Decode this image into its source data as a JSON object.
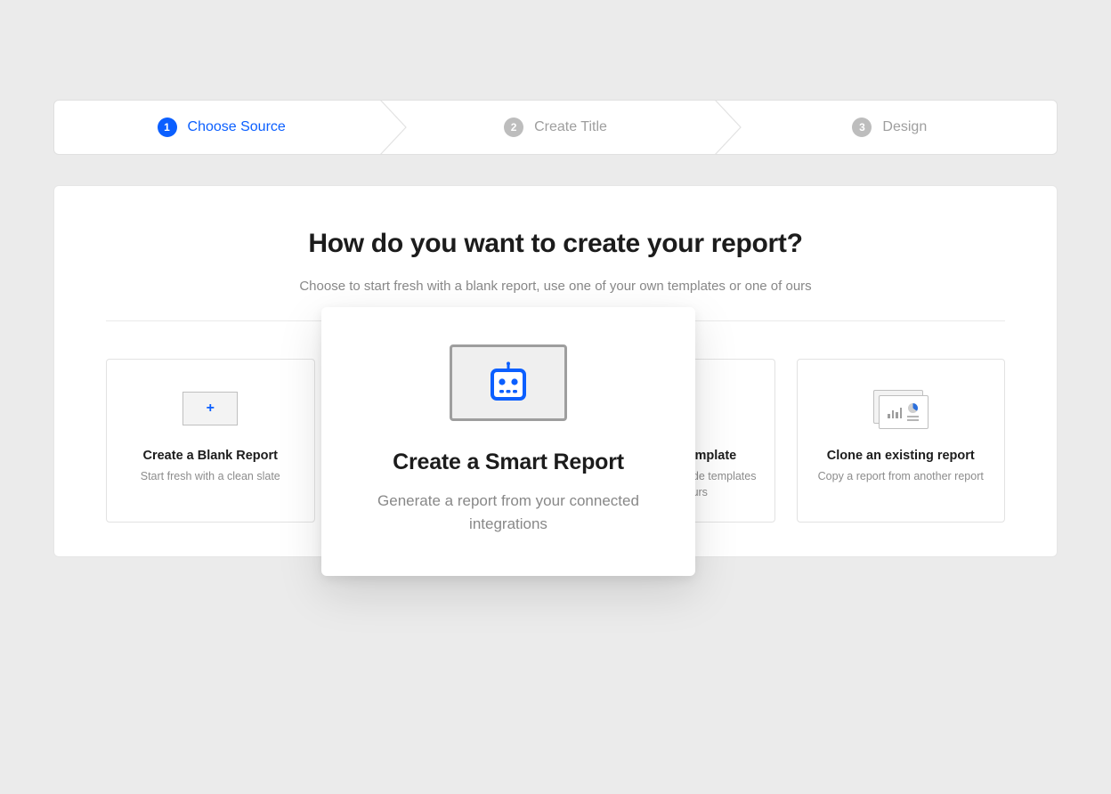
{
  "stepper": {
    "steps": [
      {
        "num": "1",
        "label": "Choose Source"
      },
      {
        "num": "2",
        "label": "Create Title"
      },
      {
        "num": "3",
        "label": "Design"
      }
    ]
  },
  "main": {
    "title": "How do you want to create your report?",
    "subtitle": "Choose to start fresh with a blank report, use one of your own templates or one of ours"
  },
  "cards": {
    "blank": {
      "title": "Create a Blank Report",
      "desc": "Start fresh with a clean slate"
    },
    "smart": {
      "title": "Create a Smart Report",
      "desc": "Generate a report from your connected integrations"
    },
    "template": {
      "title": "Start from a Template",
      "desc": "Use one of our premade templates or one of yours"
    },
    "clone": {
      "title": "Clone an existing report",
      "desc": "Copy a report from another report"
    }
  }
}
